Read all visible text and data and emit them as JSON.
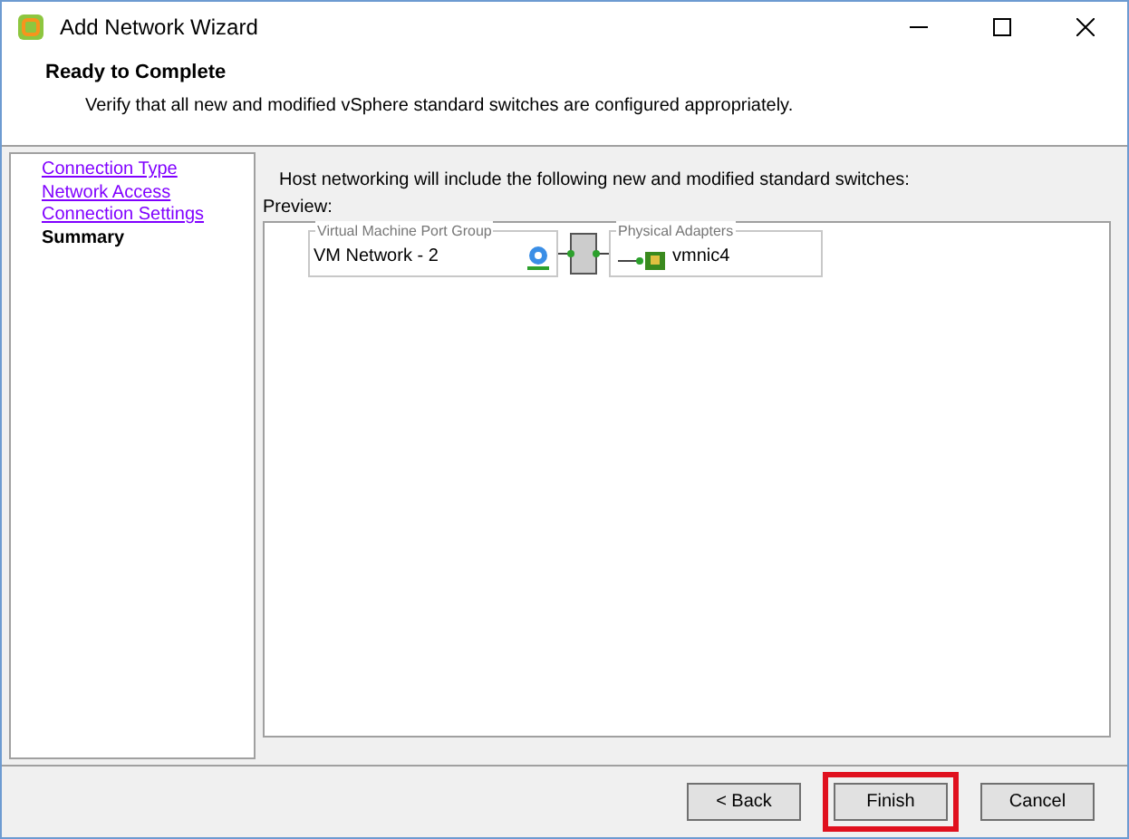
{
  "window": {
    "title": "Add Network Wizard"
  },
  "header": {
    "title": "Ready to Complete",
    "subtitle": "Verify that all new and modified vSphere standard switches are configured appropriately."
  },
  "steps": [
    {
      "label": "Connection Type",
      "selected": false
    },
    {
      "label": "Network Access",
      "selected": false
    },
    {
      "label": "Connection Settings",
      "selected": false
    },
    {
      "label": "Summary",
      "selected": true
    }
  ],
  "intro": "Host networking will include the following new and modified standard switches:",
  "preview": {
    "label": "Preview:",
    "port_group": {
      "legend": "Virtual Machine Port Group",
      "name": "VM Network - 2"
    },
    "adapters": {
      "legend": "Physical Adapters",
      "name": "vmnic4"
    }
  },
  "buttons": [
    {
      "label": "< Back",
      "highlighted": false
    },
    {
      "label": "Finish",
      "highlighted": true
    },
    {
      "label": "Cancel",
      "highlighted": false
    }
  ]
}
